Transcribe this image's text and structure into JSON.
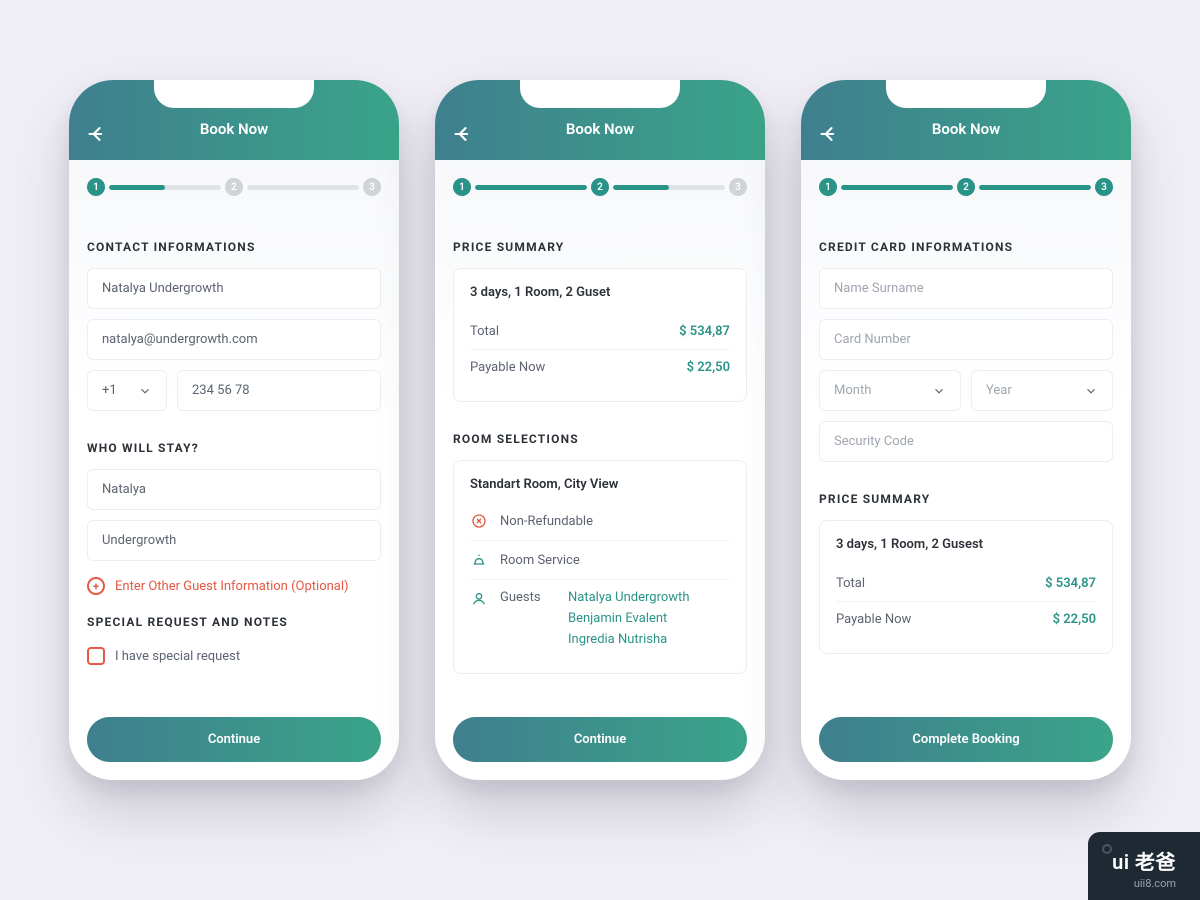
{
  "header": {
    "title": "Book Now"
  },
  "stepper": {
    "s1": "1",
    "s2": "2",
    "s3": "3"
  },
  "screen1": {
    "section_contact": "CONTACT INFORMATIONS",
    "name": "Natalya Undergrowth",
    "email": "natalya@undergrowth.com",
    "dial": "+1",
    "phone": "234 56 78",
    "section_stay": "WHO WILL STAY?",
    "first": "Natalya",
    "last": "Undergrowth",
    "add_guest": "Enter Other Guest Information (Optional)",
    "section_notes": "SPECIAL REQUEST AND NOTES",
    "special": "I have special request",
    "cta": "Continue"
  },
  "screen2": {
    "section_price": "PRICE SUMMARY",
    "summary": "3 days, 1 Room, 2 Guset",
    "total_label": "Total",
    "total_value": "$ 534,87",
    "payable_label": "Payable Now",
    "payable_value": "$ 22,50",
    "section_room": "ROOM SELECTIONS",
    "room_title": "Standart Room, City View",
    "non_refundable": "Non-Refundable",
    "room_service": "Room Service",
    "guests_label": "Guests",
    "guests": [
      "Natalya Undergrowth",
      "Benjamin Evalent",
      "Ingredia Nutrisha"
    ],
    "cta": "Continue"
  },
  "screen3": {
    "section_card": "CREDIT CARD INFORMATIONS",
    "name_ph": "Name Surname",
    "number_ph": "Card Number",
    "month_ph": "Month",
    "year_ph": "Year",
    "cvv_ph": "Security Code",
    "section_price": "PRICE SUMMARY",
    "summary": "3 days, 1 Room, 2 Gusest",
    "total_label": "Total",
    "total_value": "$ 534,87",
    "payable_label": "Payable Now",
    "payable_value": "$ 22,50",
    "cta": "Complete Booking"
  },
  "watermark": {
    "logo": "ui 老爸",
    "sub": "uii8.com"
  }
}
